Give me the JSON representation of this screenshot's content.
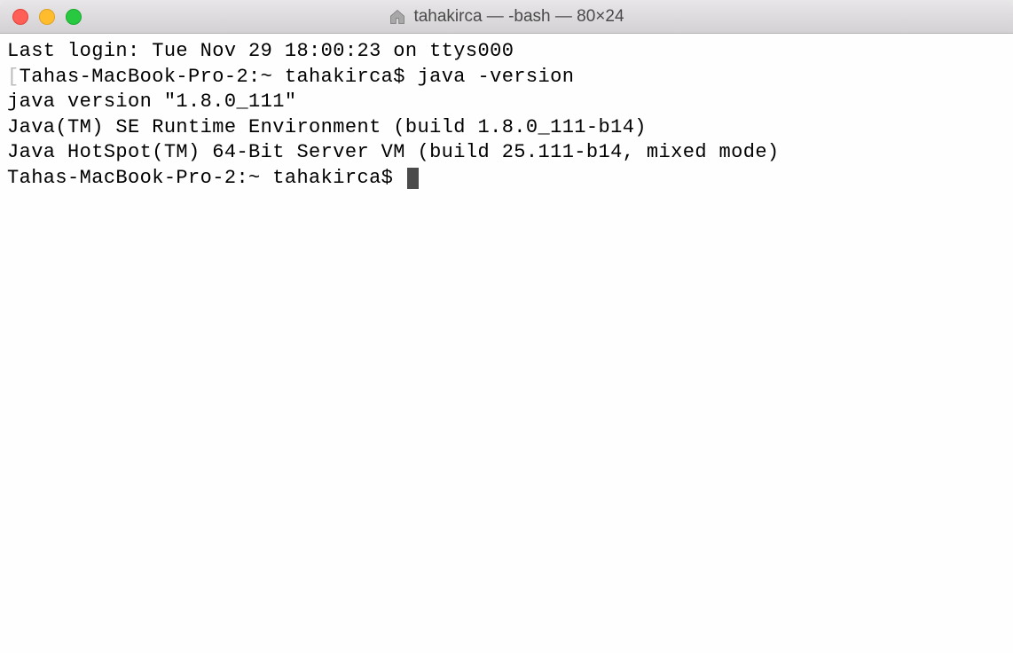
{
  "window": {
    "title": "tahakirca — -bash — 80×24"
  },
  "terminal": {
    "line1": "Last login: Tue Nov 29 18:00:23 on ttys000",
    "line2_bracket_open": "[",
    "line2_prompt": "Tahas-MacBook-Pro-2:~ tahakirca$ ",
    "line2_cmd": "java -version",
    "line2_bracket_close": "]",
    "line3": "java version \"1.8.0_111\"",
    "line4": "Java(TM) SE Runtime Environment (build 1.8.0_111-b14)",
    "line5": "Java HotSpot(TM) 64-Bit Server VM (build 25.111-b14, mixed mode)",
    "line6_prompt": "Tahas-MacBook-Pro-2:~ tahakirca$ "
  }
}
